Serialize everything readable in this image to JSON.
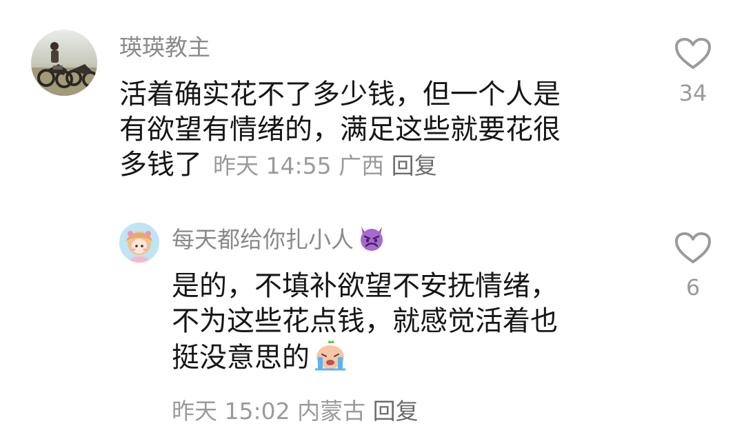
{
  "comments": [
    {
      "username": "瑛瑛教主",
      "text_lines": [
        "活着确实花不了多少钱，但一个人是",
        "有欲望有情绪的，满足这些就要花很",
        "多钱了"
      ],
      "time": "昨天 14:55",
      "location": "广西",
      "reply_label": "回复",
      "like_count": "34",
      "avatar_icon": "motorcycle-photo-avatar"
    },
    {
      "username": "每天都给你扎小人",
      "username_emoji": "smiling-devil-emoji",
      "text_lines": [
        "是的，不填补欲望不安抚情绪，",
        "不为这些花点钱，就感觉活着也",
        "挺没意思的"
      ],
      "text_emoji": "crying-face-emoji",
      "time": "昨天 15:02",
      "location": "内蒙古",
      "reply_label": "回复",
      "like_count": "6",
      "avatar_icon": "anime-girl-avatar"
    }
  ],
  "colors": {
    "username": "#8a8a8a",
    "body_text": "#161616",
    "meta": "#9a9a9a",
    "heart_outline": "#9a9a9a"
  }
}
